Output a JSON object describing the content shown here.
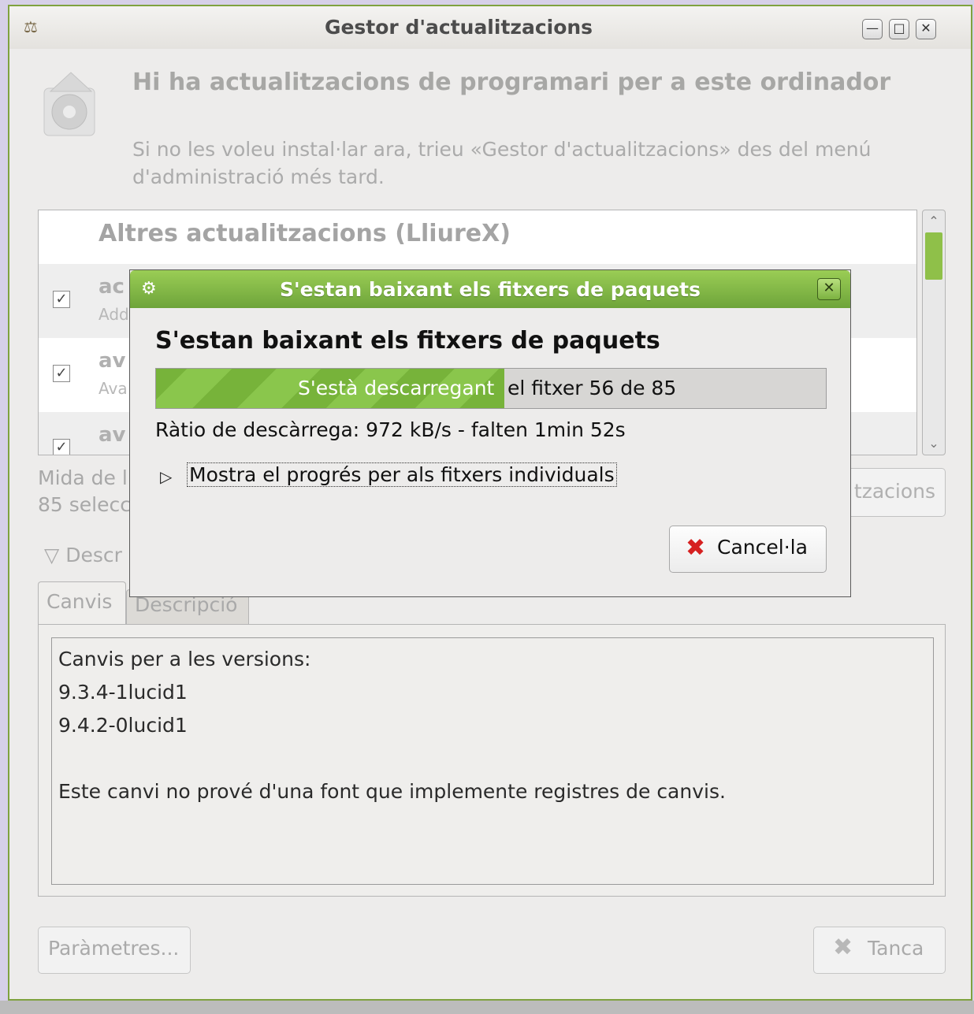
{
  "window": {
    "title": "Gestor d'actualitzacions",
    "app_icon": "update-manager-icon",
    "controls": [
      "minimize",
      "maximize",
      "close"
    ]
  },
  "header": {
    "title": "Hi ha actualitzacions de programari per a este ordinador",
    "subtitle": "Si no les voleu instal·lar ara, trieu «Gestor d'actualitzacions» des del menú d'administració més tard."
  },
  "update_list": {
    "group": "Altres actualitzacions (LliureX)",
    "rows": [
      {
        "name": "ac",
        "desc": "Add",
        "checked": true
      },
      {
        "name": "av",
        "desc": "Ava",
        "checked": true
      },
      {
        "name": "av",
        "desc": "",
        "checked": true
      }
    ]
  },
  "summary": {
    "line1": "Mida de l",
    "line2": "85 selecc",
    "check_button": "tzacions"
  },
  "description_expander": "Descr",
  "tabs": {
    "changes": "Canvis",
    "description": "Descripció"
  },
  "changes_text": [
    "Canvis per a les versions:",
    "9.3.4-1lucid1",
    "9.4.2-0lucid1",
    "",
    "Este canvi no prové d'una font que implemente registres de canvis."
  ],
  "buttons": {
    "settings": "Paràmetres...",
    "close": "Tanca"
  },
  "dialog": {
    "title": "S'estan baixant els fitxers de paquets",
    "heading": "S'estan baixant els fitxers de paquets",
    "progress_text_on_fill": "S'està descarregant",
    "progress_text_rest": "el fitxer 56 de 85",
    "progress_fraction": 0.52,
    "rate": "Ràtio de descàrrega: 972 kB/s - falten 1min 52s",
    "expander": "Mostra el progrés per als fitxers individuals",
    "cancel": "Cancel·la"
  },
  "colors": {
    "accent": "#8ac64c",
    "titlebar_green": "#7cb240"
  }
}
